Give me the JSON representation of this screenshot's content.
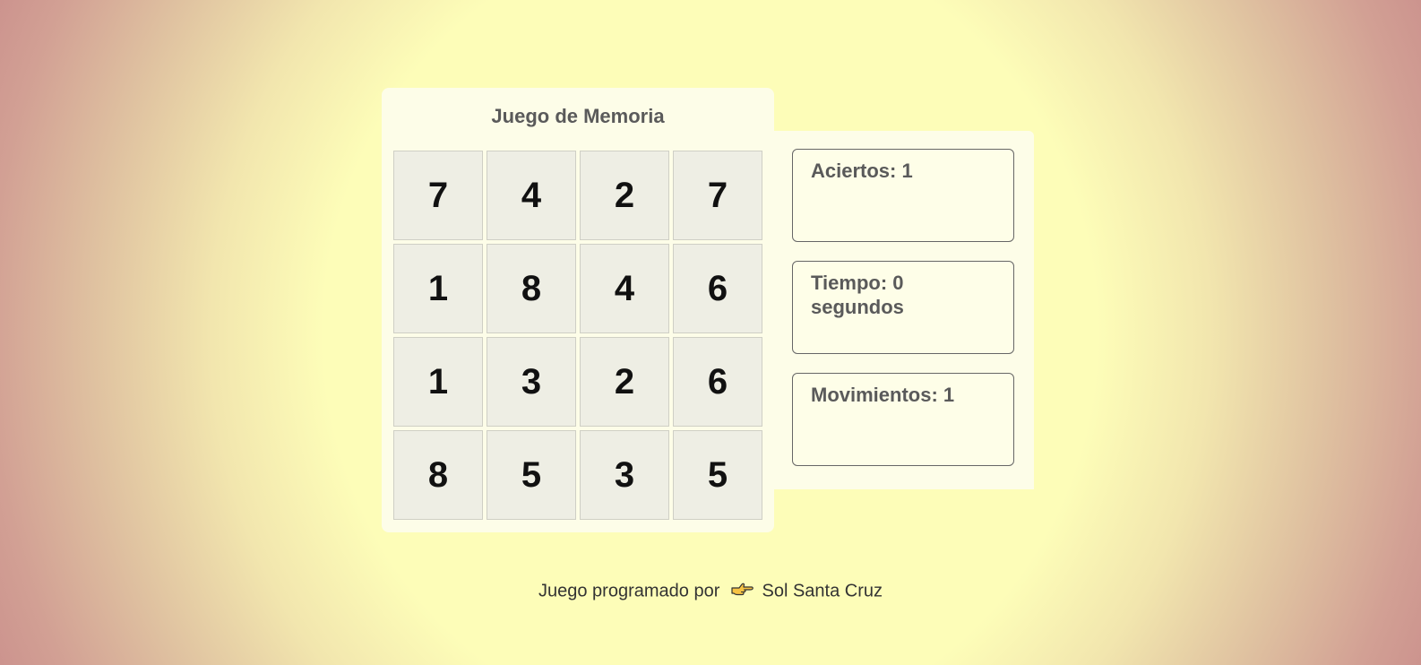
{
  "game": {
    "title": "Juego de Memoria",
    "cards": [
      "7",
      "4",
      "2",
      "7",
      "1",
      "8",
      "4",
      "6",
      "1",
      "3",
      "2",
      "6",
      "8",
      "5",
      "3",
      "5"
    ]
  },
  "stats": {
    "hits": "Aciertos: 1",
    "time": "Tiempo: 0 segundos",
    "moves": "Movimientos: 1"
  },
  "footer": {
    "text_before": "Juego programado por",
    "author": "Sol Santa Cruz",
    "icon": "pointing-hand-icon"
  },
  "colors": {
    "panel": "#fdfde8",
    "card": "#eeeee4",
    "text": "#5a5a5a"
  }
}
